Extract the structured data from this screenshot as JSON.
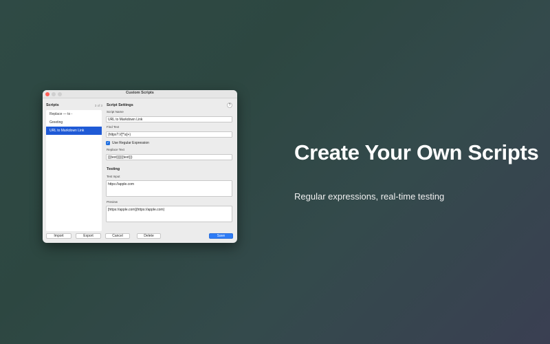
{
  "hero": {
    "title": "Create Your Own Scripts",
    "subtitle": "Regular expressions, real-time testing"
  },
  "window": {
    "title": "Custom Scripts"
  },
  "sidebar": {
    "title": "Scripts",
    "count": "3 of 3",
    "items": [
      {
        "label": "Replace — to -",
        "selected": false
      },
      {
        "label": "Greeting",
        "selected": false
      },
      {
        "label": "URL to Markdown Link",
        "selected": true
      }
    ]
  },
  "settings": {
    "title": "Script Settings",
    "help_label": "?",
    "script_name_label": "Script Name",
    "script_name_value": "URL to Markdown Link",
    "find_text_label": "Find Text",
    "find_text_value": "(https?://[^\\s]+)",
    "use_regex_label": "Use Regular Expression",
    "use_regex_checked": true,
    "replace_text_label": "Replace Text",
    "replace_text_value": "[{{text}}]({{text}})"
  },
  "testing": {
    "title": "Testing",
    "input_label": "Test Input",
    "input_value": "https://apple.com",
    "preview_label": "Preview",
    "preview_value": "[https://apple.com](https://apple.com)"
  },
  "buttons": {
    "import": "Import",
    "export": "Export",
    "cancel": "Cancel",
    "delete": "Delete",
    "save": "Save"
  },
  "colors": {
    "accent": "#2e7cf6",
    "selection": "#1f5ad6",
    "close_light": "#fe5f57"
  }
}
